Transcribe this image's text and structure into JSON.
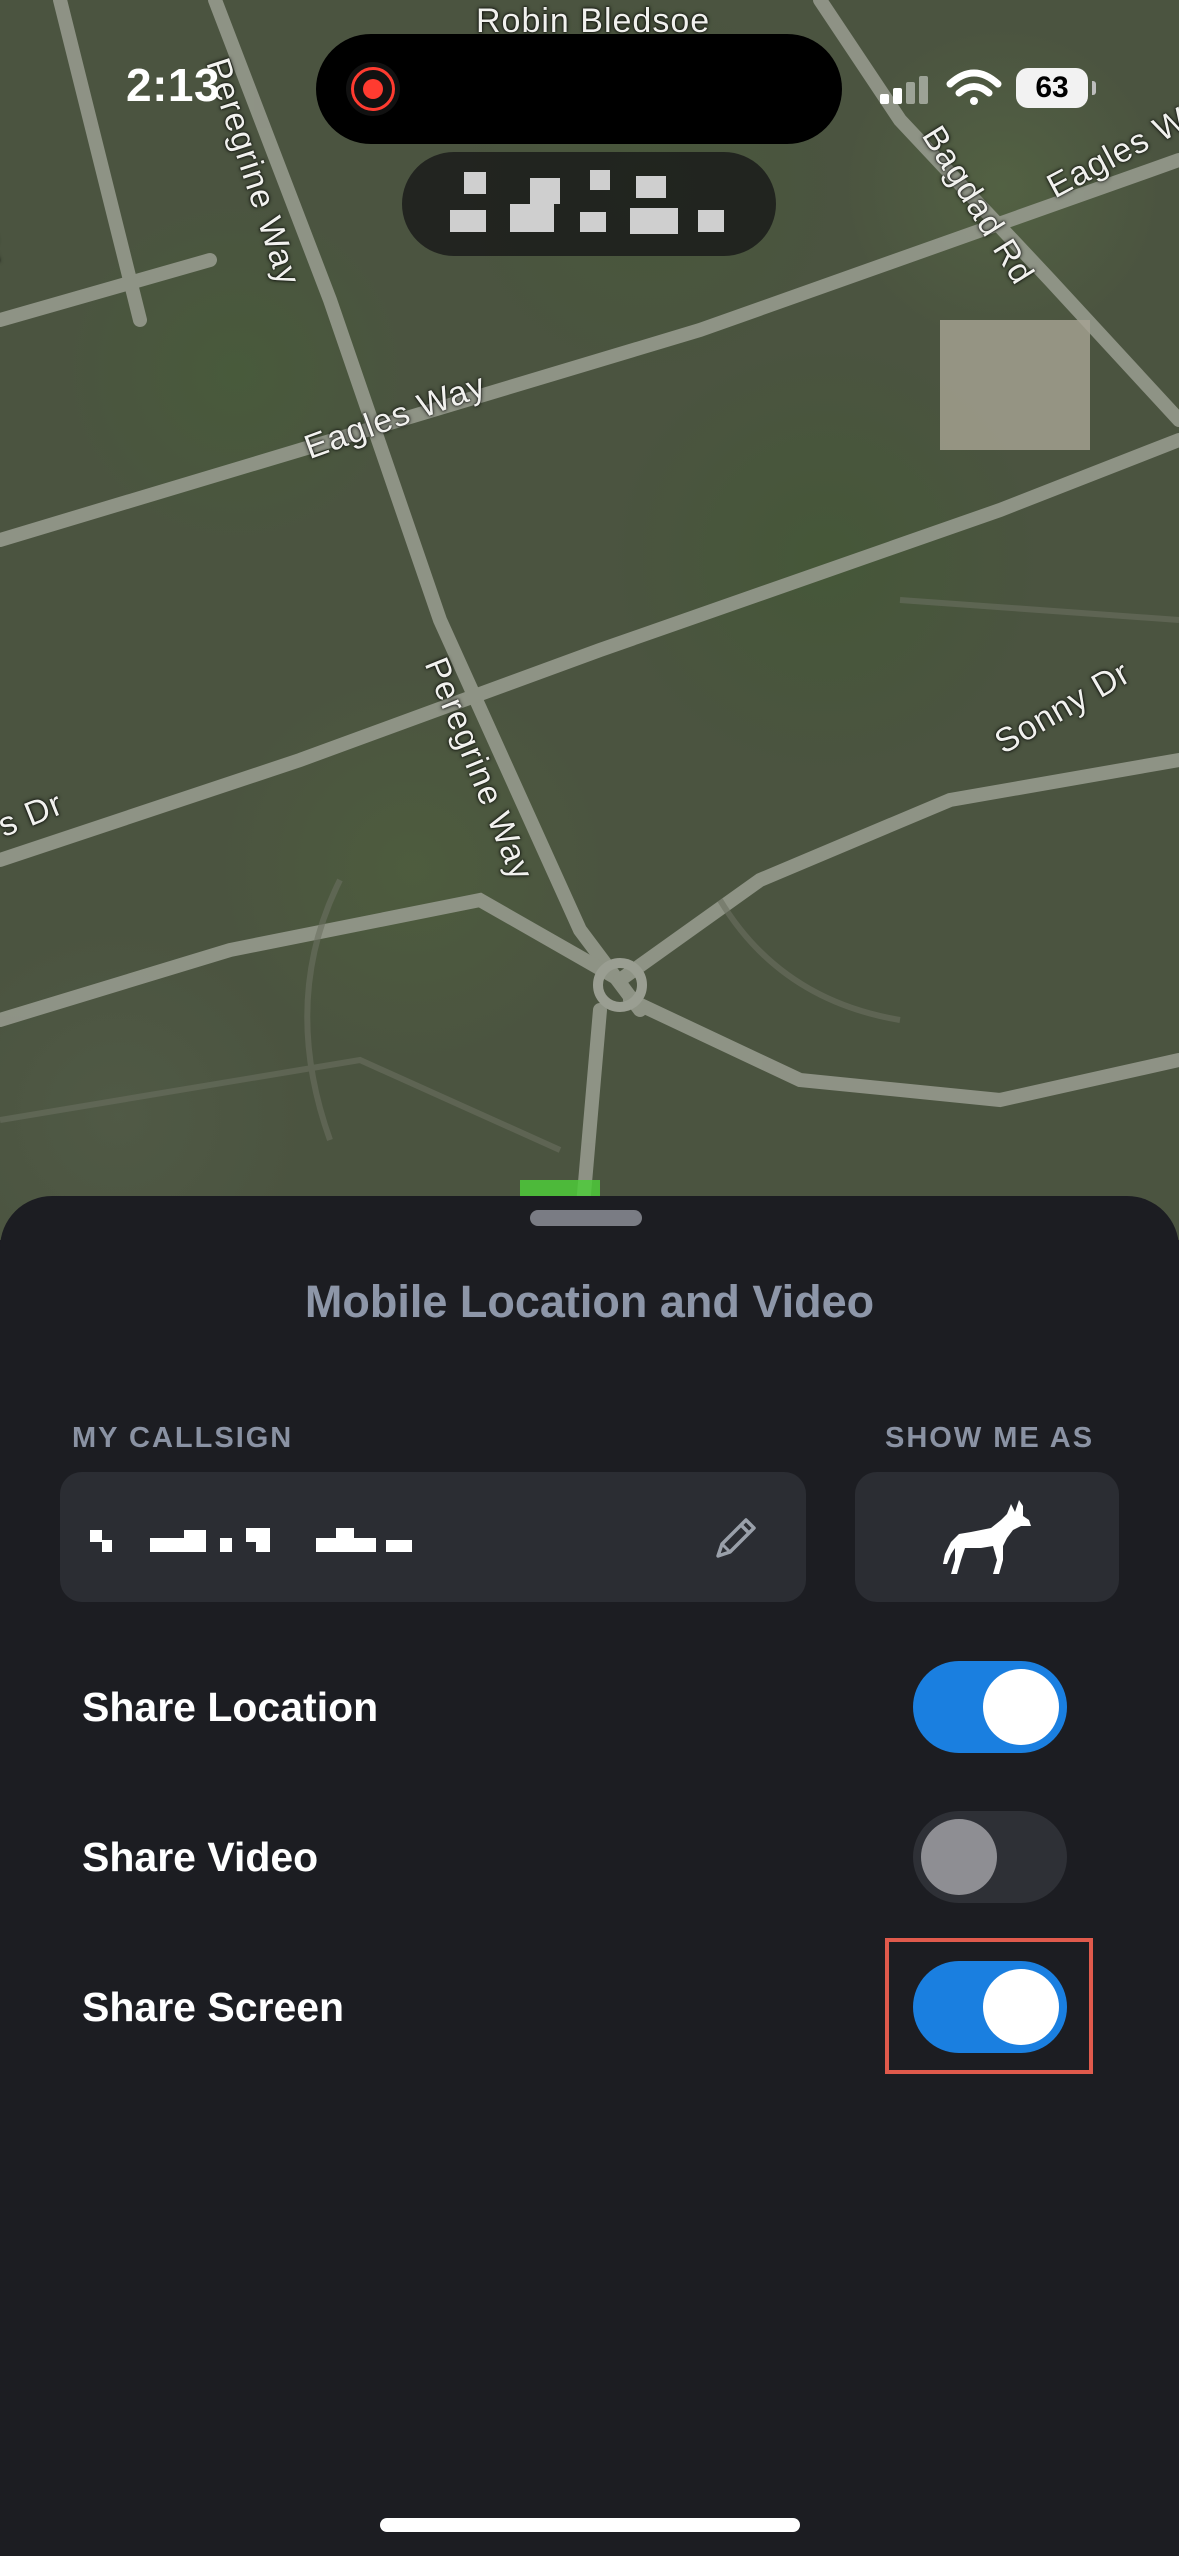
{
  "status_bar": {
    "time": "2:13",
    "battery": "63",
    "recording_color": "#ff3b30"
  },
  "map": {
    "road_labels": [
      "Robin Bledsoe",
      "Peregrine Way",
      "Eagles Way",
      "Bagdad Rd",
      "Eagles Way",
      "Peregrine Way",
      "Sonny Dr",
      "Dr",
      "s Dr"
    ]
  },
  "sheet": {
    "title": "Mobile Location and Video",
    "callsign_label": "MY CALLSIGN",
    "show_me_as_label": "SHOW ME AS",
    "avatar_icon": "dog-icon",
    "edit_icon": "pencil-icon",
    "toggles": [
      {
        "label": "Share Location",
        "on": true
      },
      {
        "label": "Share Video",
        "on": false
      },
      {
        "label": "Share Screen",
        "on": true
      }
    ],
    "accent_color": "#1a7fe0",
    "highlight_color": "#e05a4c"
  }
}
